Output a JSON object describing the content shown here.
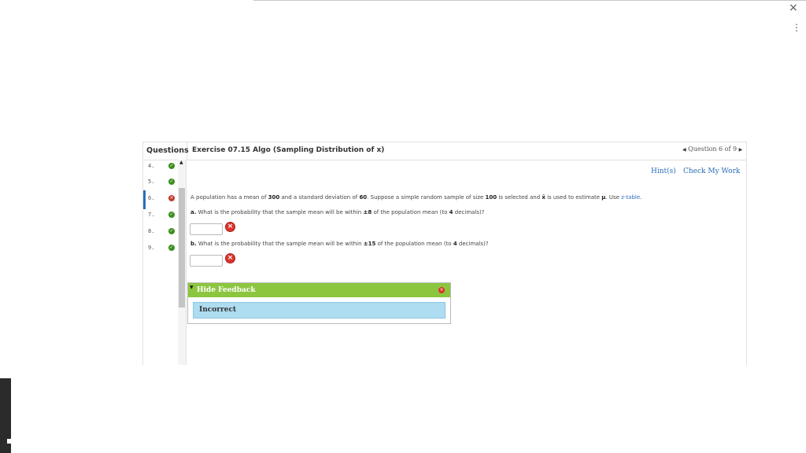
{
  "window": {
    "close_icon": "×",
    "more_icon": "⋮"
  },
  "sidebar": {
    "header": "Questions",
    "items": [
      {
        "number": "4.",
        "status": "correct",
        "glyph": "✓"
      },
      {
        "number": "5.",
        "status": "correct",
        "glyph": "✓"
      },
      {
        "number": "6.",
        "status": "incorrect",
        "glyph": "×"
      },
      {
        "number": "7.",
        "status": "correct",
        "glyph": "✓"
      },
      {
        "number": "8.",
        "status": "correct",
        "glyph": "✓"
      },
      {
        "number": "9.",
        "status": "correct",
        "glyph": "✓"
      }
    ],
    "scroll_up_icon": "▲"
  },
  "header": {
    "title": "Exercise 07.15 Algo (Sampling Distribution of x)",
    "nav": {
      "prev_icon": "◀",
      "label": "Question 6 of 9",
      "next_icon": "▶"
    }
  },
  "links": {
    "hints": "Hint(s)",
    "check": "Check My Work"
  },
  "problem": {
    "intro_pre": "A population has a mean of ",
    "mean": "300",
    "intro_mid": " and a standard deviation of ",
    "sd": "60",
    "intro_mid2": ". Suppose a simple random sample of size ",
    "n": "100",
    "intro_mid3": " is selected and ",
    "xbar": "x̄",
    "intro_mid4": " is used to estimate ",
    "mu": "μ",
    "intro_end": ". Use ",
    "ztable": "z-table",
    "period": "."
  },
  "part_a": {
    "label": "a.",
    "text_pre": " What is the probability that the sample mean will be within ",
    "pm": "±8",
    "text_post": " of the population mean (to ",
    "decimals": "4",
    "text_end": " decimals)?",
    "value": "",
    "status_icon": "×"
  },
  "part_b": {
    "label": "b.",
    "text_pre": " What is the probability that the sample mean will be within ",
    "pm": "±15",
    "text_post": " of the population mean (to ",
    "decimals": "4",
    "text_end": " decimals)?",
    "value": "",
    "status_icon": "×"
  },
  "feedback": {
    "toggle_icon": "▼",
    "title": "Hide Feedback",
    "close_icon": "×",
    "message": "Incorrect"
  },
  "colors": {
    "link": "#2a6ebb",
    "correct": "#3b8f1f",
    "incorrect": "#d9342b",
    "feedback_header": "#8cc63f",
    "feedback_body": "#aedcf0"
  }
}
